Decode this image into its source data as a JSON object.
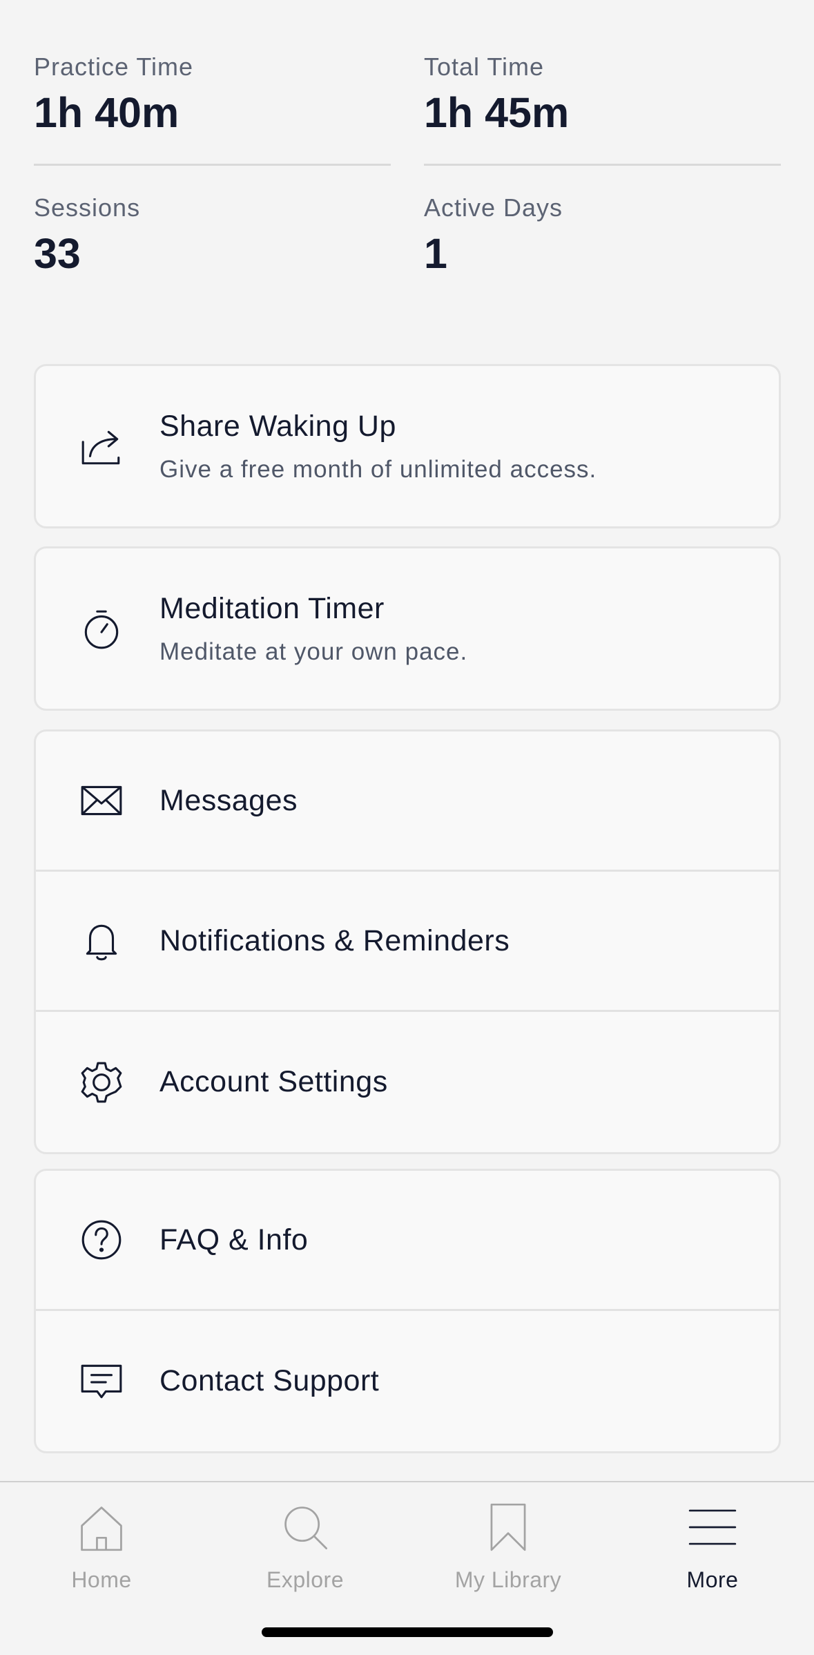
{
  "stats": [
    {
      "label": "Practice Time",
      "value": "1h 40m"
    },
    {
      "label": "Total Time",
      "value": "1h 45m"
    },
    {
      "label": "Sessions",
      "value": "33"
    },
    {
      "label": "Active Days",
      "value": "1"
    }
  ],
  "features": [
    {
      "title": "Share Waking Up",
      "subtitle": "Give a free month of unlimited access.",
      "icon": "share-icon"
    },
    {
      "title": "Meditation Timer",
      "subtitle": "Meditate at your own pace.",
      "icon": "stopwatch-icon"
    }
  ],
  "menu_group_1": [
    {
      "label": "Messages",
      "icon": "envelope-icon"
    },
    {
      "label": "Notifications & Reminders",
      "icon": "bell-icon"
    },
    {
      "label": "Account Settings",
      "icon": "gear-icon"
    }
  ],
  "menu_group_2": [
    {
      "label": "FAQ & Info",
      "icon": "question-icon"
    },
    {
      "label": "Contact Support",
      "icon": "chat-icon"
    }
  ],
  "tabbar": {
    "tabs": [
      {
        "label": "Home",
        "icon": "home-icon"
      },
      {
        "label": "Explore",
        "icon": "search-icon"
      },
      {
        "label": "My Library",
        "icon": "bookmark-icon"
      },
      {
        "label": "More",
        "icon": "menu-icon"
      }
    ],
    "active": "More"
  },
  "colors": {
    "text": "#141a2e",
    "muted": "#5c6373",
    "inactive_tab": "#a3a3a3",
    "background": "#f4f4f4"
  }
}
